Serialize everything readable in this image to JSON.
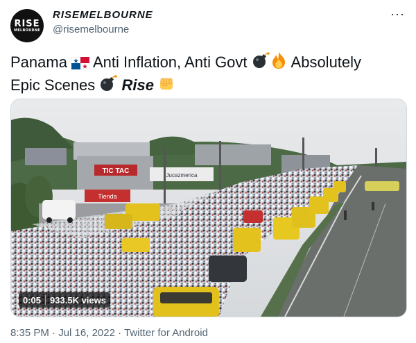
{
  "tweet": {
    "avatar_text_top": "RISE",
    "avatar_text_bottom": "MELBOURNE",
    "display_name": "RISEMELBOURNE",
    "handle": "@risemelbourne",
    "more_label": "···",
    "text_part1": "Panama ",
    "flag_icon": "panama-flag-icon",
    "text_part2": " Anti Inflation, Anti Govt ",
    "bomb_icon": "bomb-icon",
    "fire_icon": "fire-icon",
    "text_part3": " Absolutely",
    "text_part4": "Epic Scenes ",
    "rise_word": "Rise",
    "fist_icon": "fist-icon"
  },
  "media": {
    "shop_sign": "TIC TAC",
    "sign2": "Tienda",
    "sign3": "Jucazmerica",
    "duration": "0:05",
    "views": "933.5K views"
  },
  "footer": {
    "time": "8:35 PM",
    "dot1": " · ",
    "date": "Jul 16, 2022",
    "dot2": " · ",
    "source": "Twitter for Android"
  }
}
